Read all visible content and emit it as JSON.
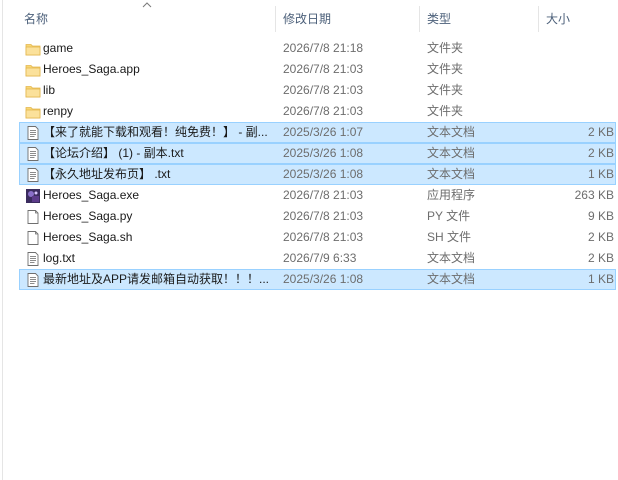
{
  "columns": {
    "name": "名称",
    "date": "修改日期",
    "type": "类型",
    "size": "大小"
  },
  "files": [
    {
      "name": "game",
      "date": "2026/7/8 21:18",
      "type": "文件夹",
      "size": "",
      "icon": "folder-icon",
      "selected": false
    },
    {
      "name": "Heroes_Saga.app",
      "date": "2026/7/8 21:03",
      "type": "文件夹",
      "size": "",
      "icon": "folder-icon",
      "selected": false
    },
    {
      "name": "lib",
      "date": "2026/7/8 21:03",
      "type": "文件夹",
      "size": "",
      "icon": "folder-icon",
      "selected": false
    },
    {
      "name": "renpy",
      "date": "2026/7/8 21:03",
      "type": "文件夹",
      "size": "",
      "icon": "folder-icon",
      "selected": false
    },
    {
      "name": "【来了就能下载和观看！纯免费！】 - 副...",
      "date": "2025/3/26 1:07",
      "type": "文本文档",
      "size": "2 KB",
      "icon": "text-document-icon",
      "selected": true
    },
    {
      "name": "【论坛介绍】 (1) - 副本.txt",
      "date": "2025/3/26 1:08",
      "type": "文本文档",
      "size": "2 KB",
      "icon": "text-document-icon",
      "selected": true
    },
    {
      "name": "【永久地址发布页】 .txt",
      "date": "2025/3/26 1:08",
      "type": "文本文档",
      "size": "1 KB",
      "icon": "text-document-icon",
      "selected": true
    },
    {
      "name": "Heroes_Saga.exe",
      "date": "2026/7/8 21:03",
      "type": "应用程序",
      "size": "263 KB",
      "icon": "application-icon",
      "selected": false
    },
    {
      "name": "Heroes_Saga.py",
      "date": "2026/7/8 21:03",
      "type": "PY 文件",
      "size": "9 KB",
      "icon": "blank-file-icon",
      "selected": false
    },
    {
      "name": "Heroes_Saga.sh",
      "date": "2026/7/8 21:03",
      "type": "SH 文件",
      "size": "2 KB",
      "icon": "blank-file-icon",
      "selected": false
    },
    {
      "name": "log.txt",
      "date": "2026/7/9 6:33",
      "type": "文本文档",
      "size": "2 KB",
      "icon": "text-document-icon",
      "selected": false
    },
    {
      "name": "最新地址及APP请发邮箱自动获取！！！...",
      "date": "2025/3/26 1:08",
      "type": "文本文档",
      "size": "1 KB",
      "icon": "text-document-icon",
      "selected": true
    }
  ],
  "colors": {
    "selection_fill": "#cce8ff",
    "selection_border": "#99d1ff",
    "header_text": "#4c607a",
    "folder": "#f8d775"
  }
}
